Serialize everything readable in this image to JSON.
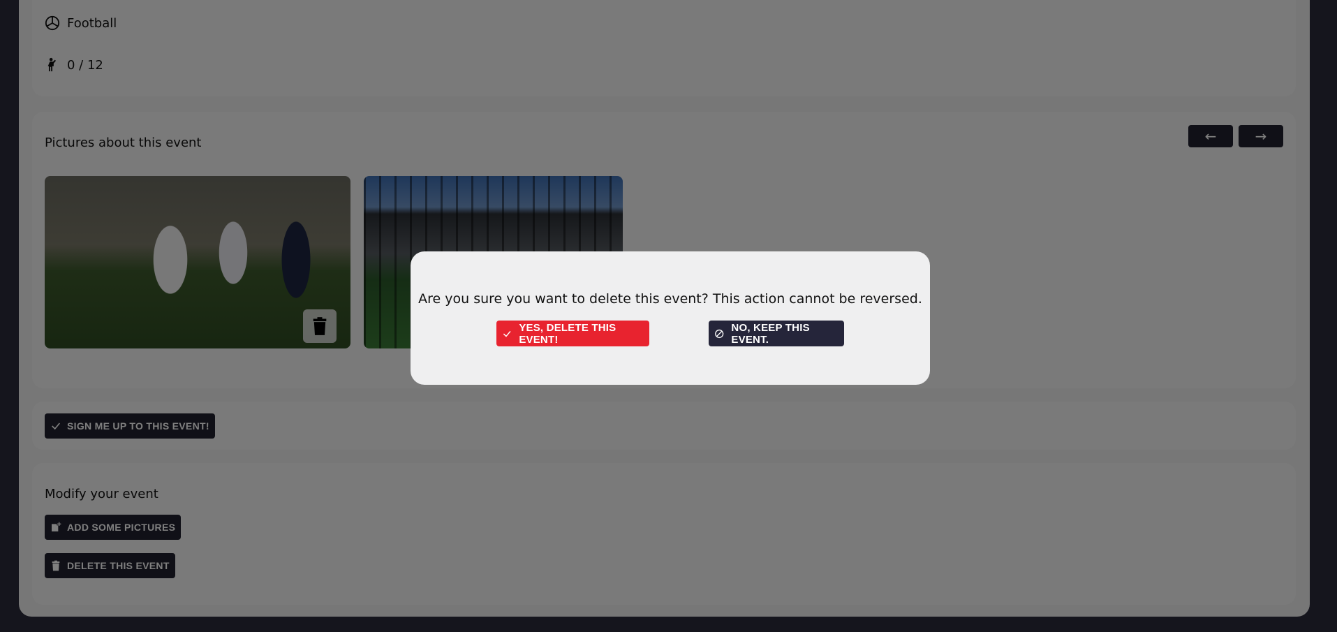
{
  "event_info": {
    "sport": "Football",
    "participants": "0 / 12"
  },
  "pictures": {
    "title": "Pictures about this event",
    "prev_label": "←",
    "next_label": "→",
    "items": [
      {
        "alt": "soccer-players-photo"
      },
      {
        "alt": "stadium-photo"
      }
    ]
  },
  "signup": {
    "label": "SIGN ME UP TO THIS EVENT!"
  },
  "modify": {
    "title": "Modify your event",
    "add_pictures_label": "ADD SOME PICTURES",
    "delete_label": "DELETE THIS EVENT"
  },
  "modal": {
    "message": "Are you sure you want to delete this event? This action cannot be reversed.",
    "confirm_label": "YES, DELETE THIS EVENT!",
    "cancel_label": "NO, KEEP THIS EVENT."
  },
  "colors": {
    "danger": "#e8232f",
    "dark": "#20202e",
    "background": "#2b2b3a"
  }
}
